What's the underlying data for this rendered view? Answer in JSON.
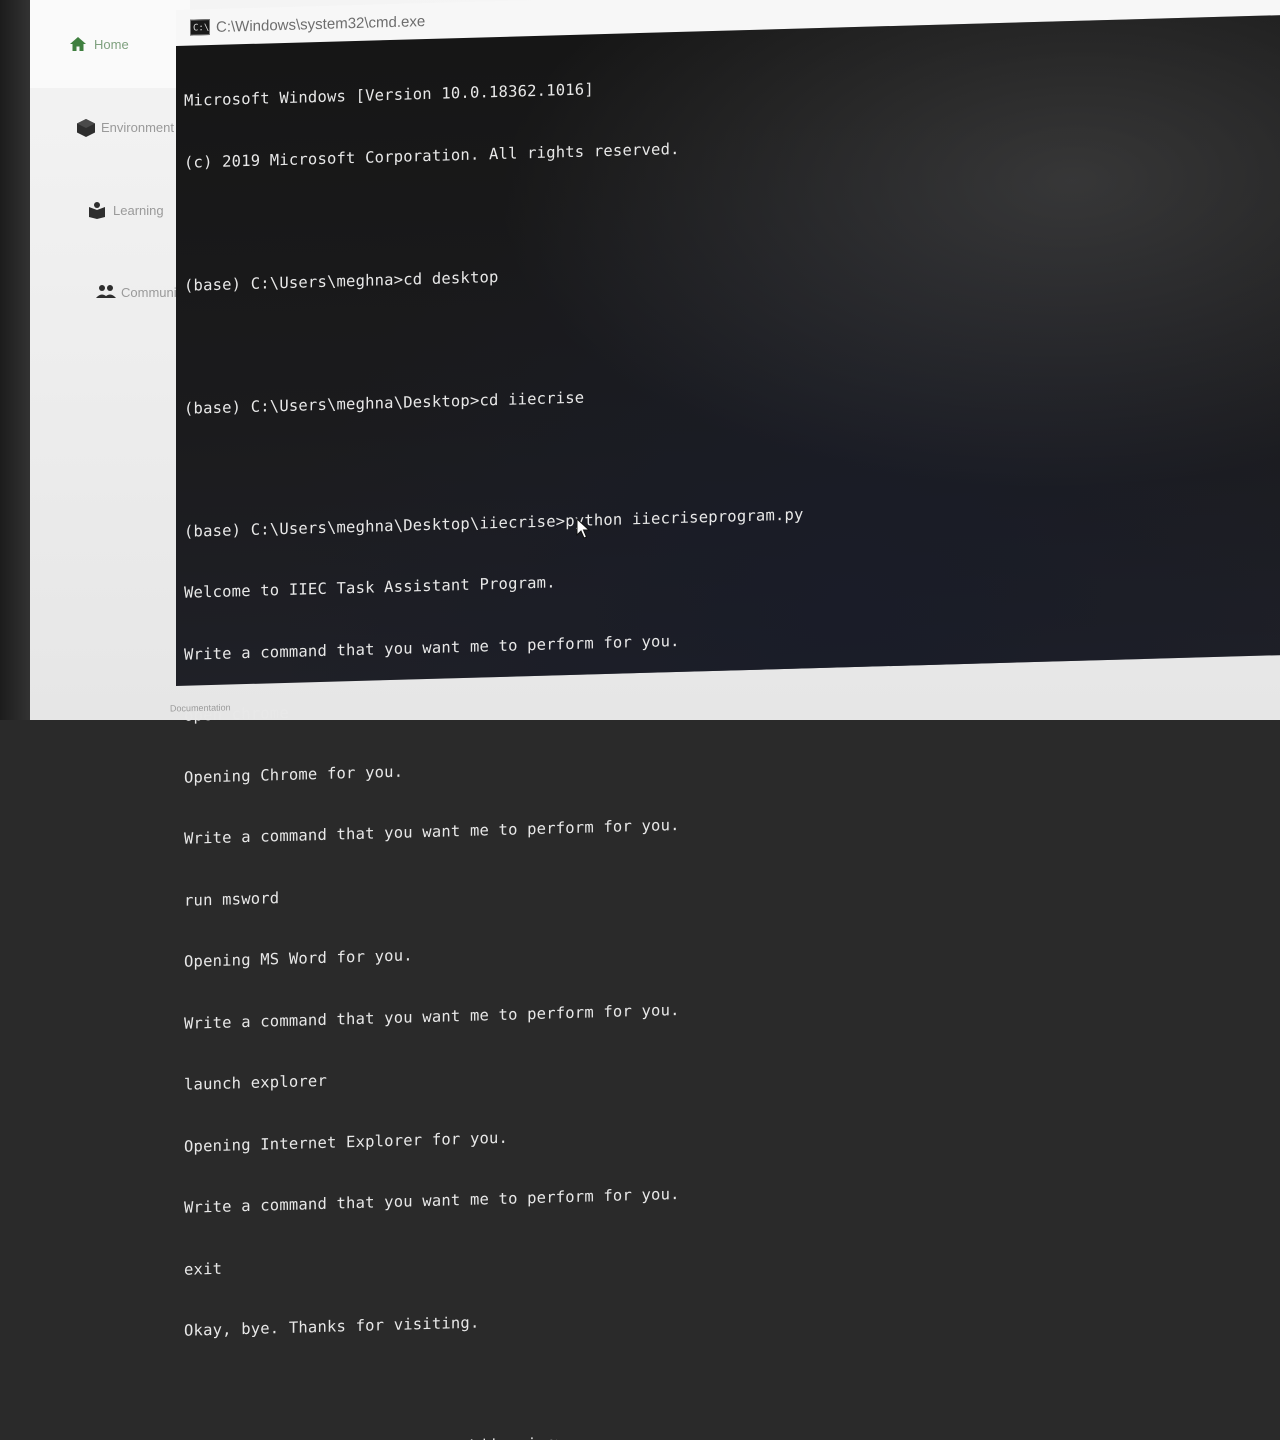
{
  "sidebar": {
    "items": [
      {
        "label": "Home",
        "icon": "home-icon"
      },
      {
        "label": "Environment",
        "icon": "cube-icon"
      },
      {
        "label": "Learning",
        "icon": "book-icon"
      },
      {
        "label": "Community",
        "icon": "people-icon"
      }
    ],
    "footer_link": "Documentation"
  },
  "cmd": {
    "title": "C:\\Windows\\system32\\cmd.exe",
    "icon_text": "C:\\",
    "lines": [
      "Microsoft Windows [Version 10.0.18362.1016]",
      "(c) 2019 Microsoft Corporation. All rights reserved.",
      "",
      "(base) C:\\Users\\meghna>cd desktop",
      "",
      "(base) C:\\Users\\meghna\\Desktop>cd iiecrise",
      "",
      "(base) C:\\Users\\meghna\\Desktop\\iiecrise>python iiecriseprogram.py",
      "Welcome to IIEC Task Assistant Program.",
      "Write a command that you want me to perform for you.",
      "open chrome",
      "Opening Chrome for you.",
      "Write a command that you want me to perform for you.",
      "run msword",
      "Opening MS Word for you.",
      "Write a command that you want me to perform for you.",
      "launch explorer",
      "Opening Internet Explorer for you.",
      "Write a command that you want me to perform for you.",
      "exit",
      "Okay, bye. Thanks for visiting.",
      "",
      "(base) C:\\Users\\meghna\\Desktop\\iiecrise>"
    ]
  },
  "colors": {
    "terminal_bg": "#1b1b1d",
    "terminal_text": "#e8e8e8",
    "home_accent": "#7ea07e"
  }
}
